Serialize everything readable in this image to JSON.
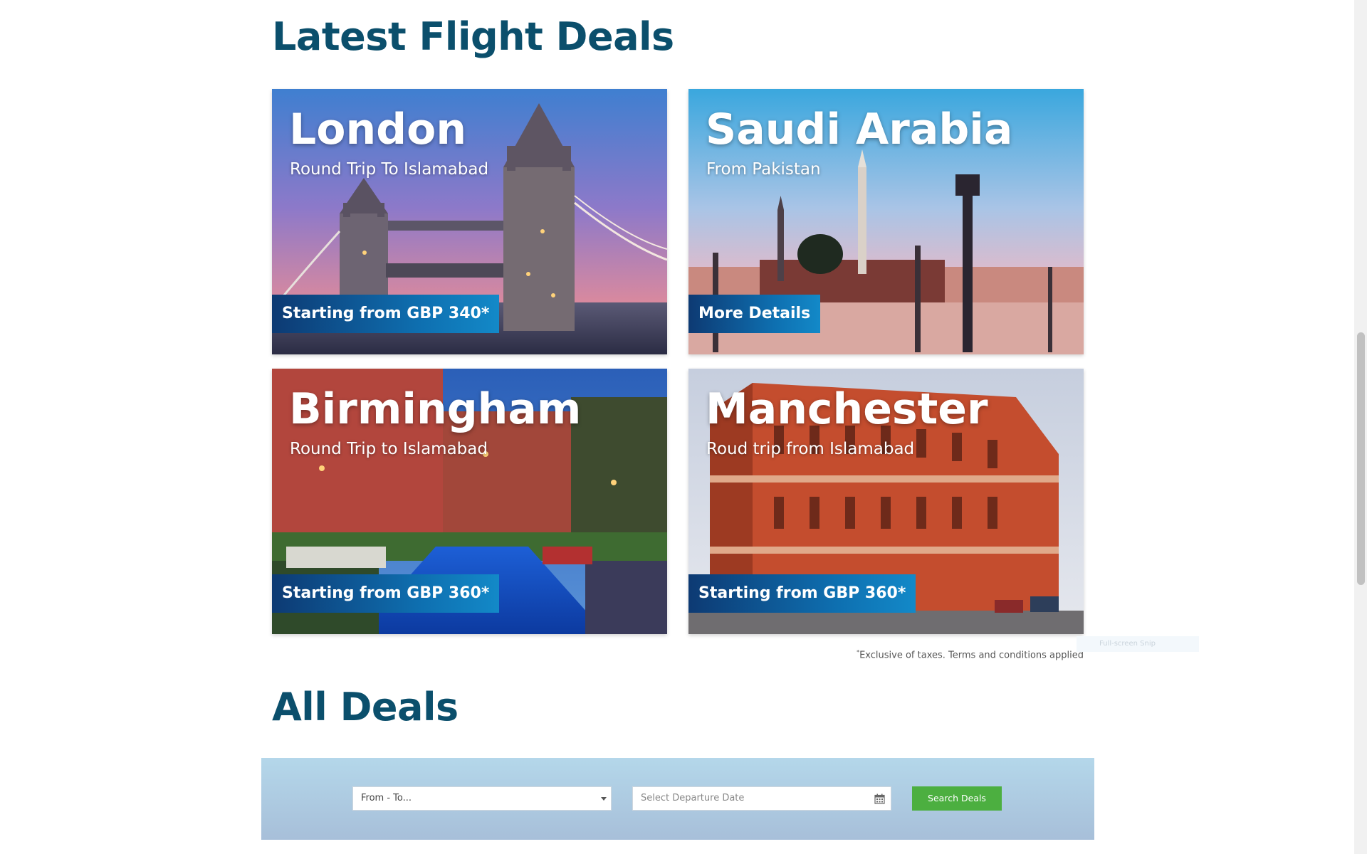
{
  "latest": {
    "title": "Latest Flight Deals",
    "deals": [
      {
        "city": "London",
        "subtitle": "Round Trip To Islamabad",
        "badge": "Starting from GBP 340*"
      },
      {
        "city": "Saudi Arabia",
        "subtitle": "From Pakistan",
        "badge": "More Details"
      },
      {
        "city": "Birmingham",
        "subtitle": "Round Trip to Islamabad",
        "badge": "Starting from GBP 360*"
      },
      {
        "city": "Manchester",
        "subtitle": "Roud trip from Islamabad",
        "badge": "Starting from GBP 360*"
      }
    ],
    "disclaimer_mark": "*",
    "disclaimer": "Exclusive of taxes. Terms and conditions applied",
    "fullscreen_snip": "Full-screen Snip"
  },
  "all": {
    "title": "All Deals",
    "route_placeholder": "From - To...",
    "date_placeholder": "Select Departure Date",
    "search_label": "Search Deals"
  },
  "colors": {
    "heading": "#0b4f6c",
    "badge": "#0e6fb0",
    "search_button": "#4caf40",
    "panel": "#b4d7ea"
  },
  "icons": [
    "dropdown-caret-icon",
    "calendar-icon"
  ]
}
